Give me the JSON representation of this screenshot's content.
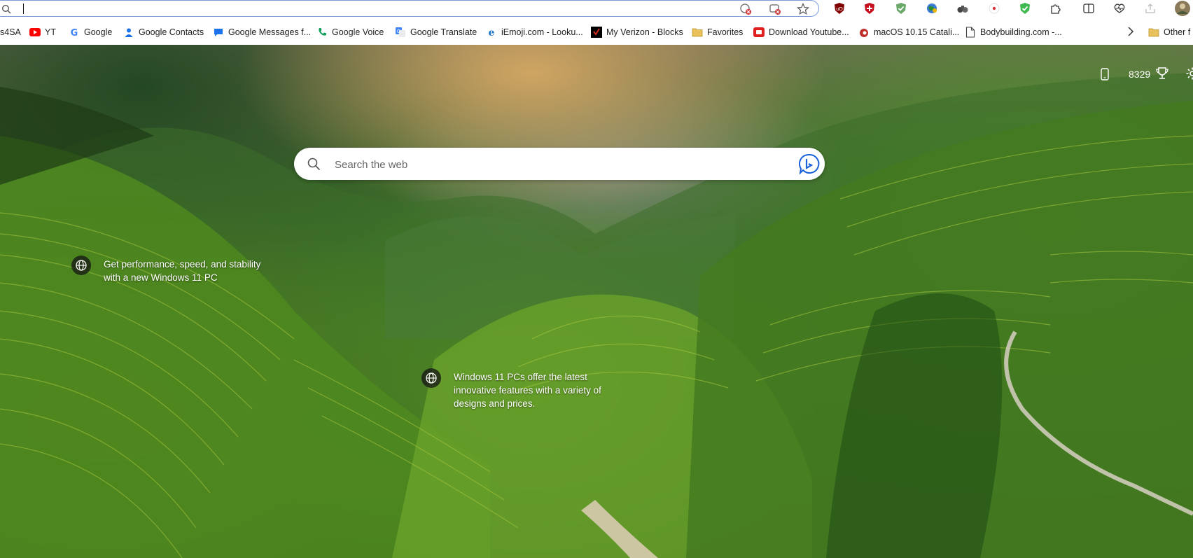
{
  "address_bar": {
    "value": "",
    "placeholder": ""
  },
  "toolbar_icons": [
    "tracking-prevention-icon",
    "app-available-icon",
    "favorite-star-icon",
    "ublock-icon",
    "shield-icon",
    "checkmark-shield-icon",
    "globe-ext-icon",
    "binoculars-icon",
    "record-icon",
    "green-shield-icon",
    "extensions-icon",
    "split-screen-icon",
    "browser-essentials-icon",
    "share-icon"
  ],
  "bookmarks": [
    {
      "label": "s4SA",
      "icon": "none"
    },
    {
      "label": "YT",
      "icon": "youtube-icon"
    },
    {
      "label": "Google",
      "icon": "google-icon"
    },
    {
      "label": "Google Contacts",
      "icon": "contacts-icon"
    },
    {
      "label": "Google Messages f...",
      "icon": "messages-icon"
    },
    {
      "label": "Google Voice",
      "icon": "voice-icon"
    },
    {
      "label": "Google Translate",
      "icon": "translate-icon"
    },
    {
      "label": "iEmoji.com - Looku...",
      "icon": "ie-icon"
    },
    {
      "label": "My Verizon - Blocks",
      "icon": "verizon-icon"
    },
    {
      "label": "Favorites",
      "icon": "folder-icon"
    },
    {
      "label": "Download Youtube...",
      "icon": "download-icon"
    },
    {
      "label": "macOS 10.15 Catali...",
      "icon": "mac-icon"
    },
    {
      "label": "Bodybuilding.com -...",
      "icon": "page-icon"
    }
  ],
  "other_favorites": "Other f",
  "ntp": {
    "rewards_points": "8329",
    "search_placeholder": "Search the web",
    "hotspots": [
      {
        "text": "Get performance, speed, and stability with a new Windows 11 PC"
      },
      {
        "text": "Windows 11 PCs offer the latest innovative features with a variety of designs and prices."
      }
    ]
  },
  "colors": {
    "accent": "#0f6cbd",
    "omnibox_border": "#7a9bd8",
    "bing_blue": "#1b62d8"
  }
}
